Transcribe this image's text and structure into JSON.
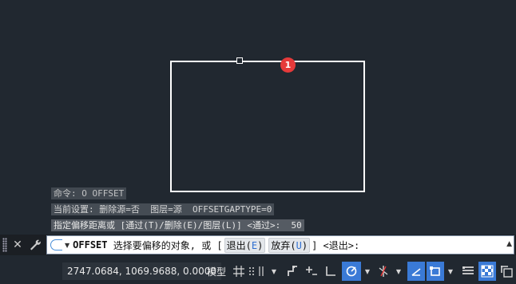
{
  "history": {
    "line1": "命令: O OFFSET",
    "line2": "当前设置: 删除源=否  图层=源  OFFSETGAPTYPE=0",
    "line3": "指定偏移距离或 [通过(T)/删除(E)/图层(L)] <通过>:  50"
  },
  "marker": {
    "number": "1",
    "color": "#e63a3a"
  },
  "command": {
    "name": "OFFSET",
    "prompt": "选择要偏移的对象, 或 [",
    "opt1_label": "退出(",
    "opt1_key": "E",
    "opt1_close": ")",
    "opt2_label": "放弃(",
    "opt2_key": "U",
    "opt2_close": ")",
    "suffix": "] <退出>:",
    "icon": "offset-command-icon"
  },
  "status": {
    "coords": "2747.0684, 1069.9688, 0.0000",
    "model_label": "模型",
    "accent": "#3a7ad6"
  }
}
